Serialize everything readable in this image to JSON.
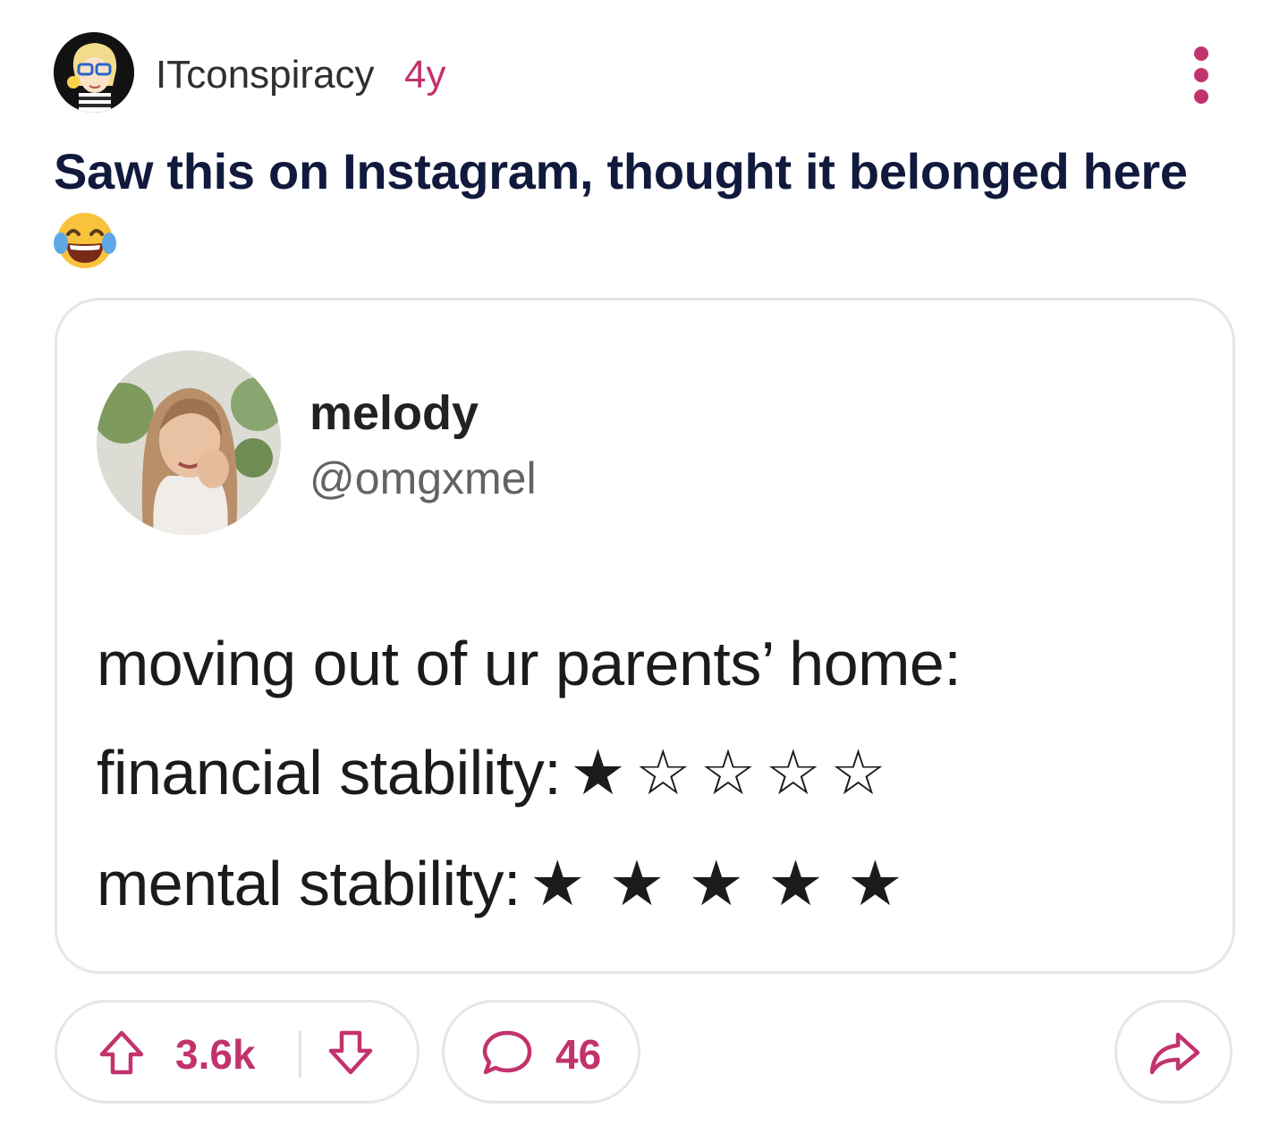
{
  "post": {
    "author": "ITconspiracy",
    "age": "4y",
    "title": "Saw this on Instagram, thought it belonged here",
    "title_emoji": "face-with-tears-of-joy"
  },
  "embedded_post": {
    "display_name": "melody",
    "handle": "@omgxmel",
    "lines": {
      "line1": "moving out of ur parents’ home:",
      "line2_label": "financial stability:",
      "line2_stars": "★☆☆☆☆",
      "line3_label": "mental stability:",
      "line3_stars": "★★★★★"
    },
    "ratings": {
      "financial_stability": 1,
      "mental_stability": 5,
      "max": 5
    }
  },
  "actions": {
    "upvotes": "3.6k",
    "comments": "46"
  },
  "colors": {
    "accent": "#c2336d",
    "title": "#111a3d",
    "border": "#e6e6e8"
  },
  "icons": {
    "avatar": "cartoon-avatar-icon",
    "more": "more-vertical-icon",
    "upvote": "arrow-up-icon",
    "downvote": "arrow-down-icon",
    "comment": "speech-bubble-icon",
    "share": "share-arrow-icon"
  }
}
